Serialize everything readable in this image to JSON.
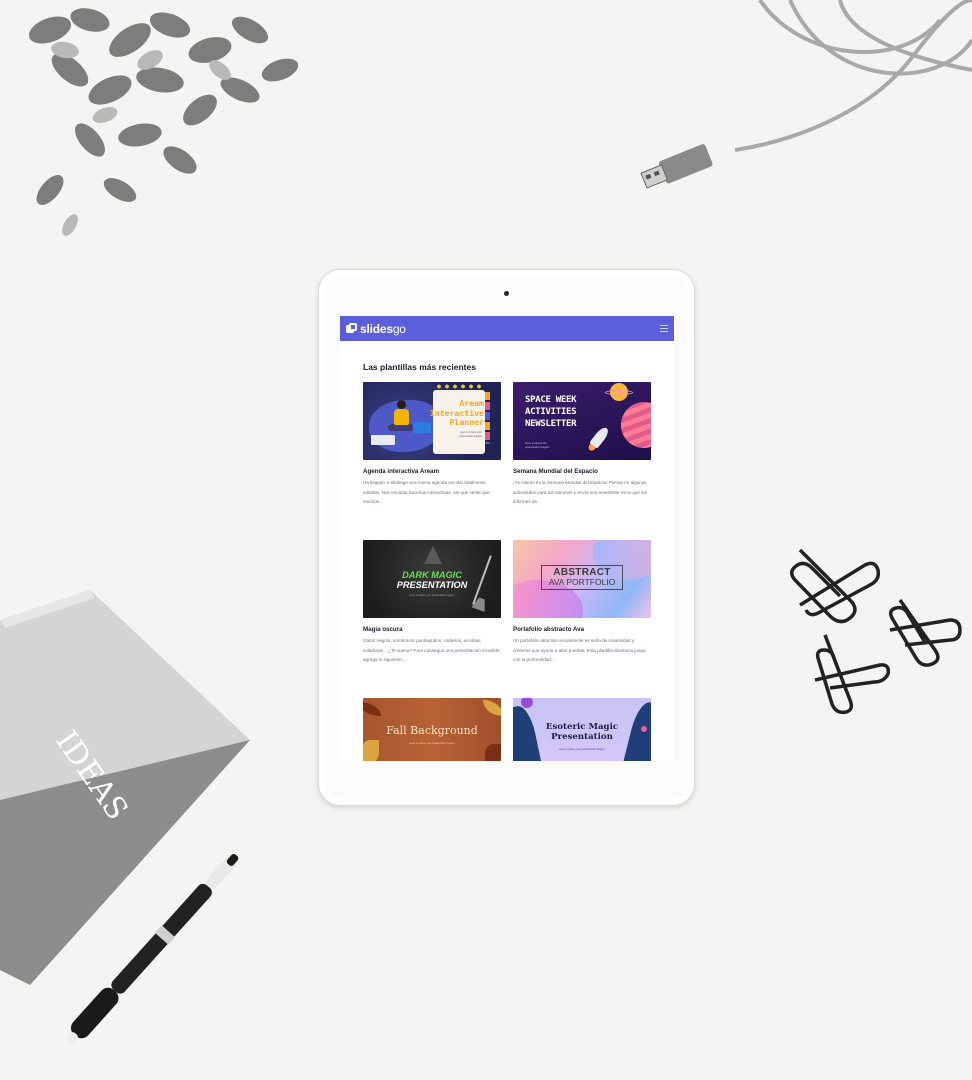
{
  "app": {
    "logo_bold": "slides",
    "logo_light": "go"
  },
  "colors": {
    "topbar": "#5b5fdc",
    "title_text": "#1b1b2b",
    "body_text": "#6b6f86"
  },
  "page": {
    "section_title": "Las plantillas más recientes"
  },
  "templates": [
    {
      "name": "Agenda interactiva Aream",
      "description": "Ha llegado a Slidesgo una nueva agenda escolar totalmente editable. Nos encanta hacerlas interactivas, así que verás que muchos...",
      "thumb_title_1": "Aream",
      "thumb_title_2": "Interactive",
      "thumb_title_3": "Planner",
      "thumb_sub": "Here is where your presentation begins"
    },
    {
      "name": "Semana Mundial del Espacio",
      "description": "¡Ya mismo es la Semana Mundial del Espacio! Piensa en algunas actividades para tus alumnos y envía una newsletter en la que les informes de...",
      "thumb_title_1": "SPACE WEEK",
      "thumb_title_2": "ACTIVITIES",
      "thumb_title_3": "NEWSLETTER",
      "thumb_sub": "Here is where the presentation begins"
    },
    {
      "name": "Magia oscura",
      "description": "Gatos negros, sombreros puntiagudos, calderos, escobas voladoras... ¿Te suena? Para conseguir una presentación increíble, agrega lo siguiente:...",
      "thumb_title_1": "DARK MAGIC",
      "thumb_title_2": "PRESENTATION",
      "thumb_sub": "Here is where your presentation begins"
    },
    {
      "name": "Portafolio abstracto Ava",
      "description": "Un portafolio atractivo visualmente es seña de creatividad y creemos que ayuda a abrir puertas. Esta plantilla abstracta juega con la profundidad...",
      "thumb_title_1": "ABSTRACT",
      "thumb_title_2": "AVA PORTFOLIO"
    },
    {
      "thumb_title_1": "Fall Background",
      "thumb_sub": "Here is where your presentation begins"
    },
    {
      "thumb_title_1": "Esoteric Magic",
      "thumb_title_2": "Presentation",
      "thumb_sub": "Here is where your presentation begins"
    }
  ],
  "props": {
    "notebook_label": "IDEAS"
  },
  "icons": [
    "slidesgo-logo-icon",
    "hamburger-menu-icon"
  ]
}
